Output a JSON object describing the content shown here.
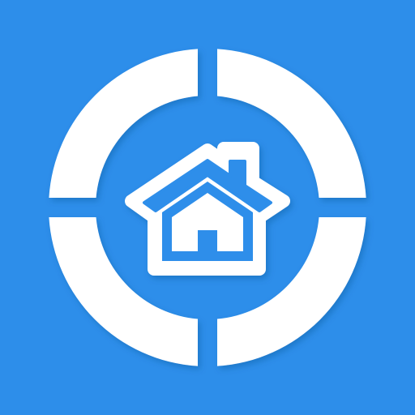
{
  "icon": {
    "name": "home-target-icon",
    "colors": {
      "background": "#2D8EEA",
      "foreground": "#FFFFFF",
      "shadow": "#1A5F9E"
    }
  }
}
